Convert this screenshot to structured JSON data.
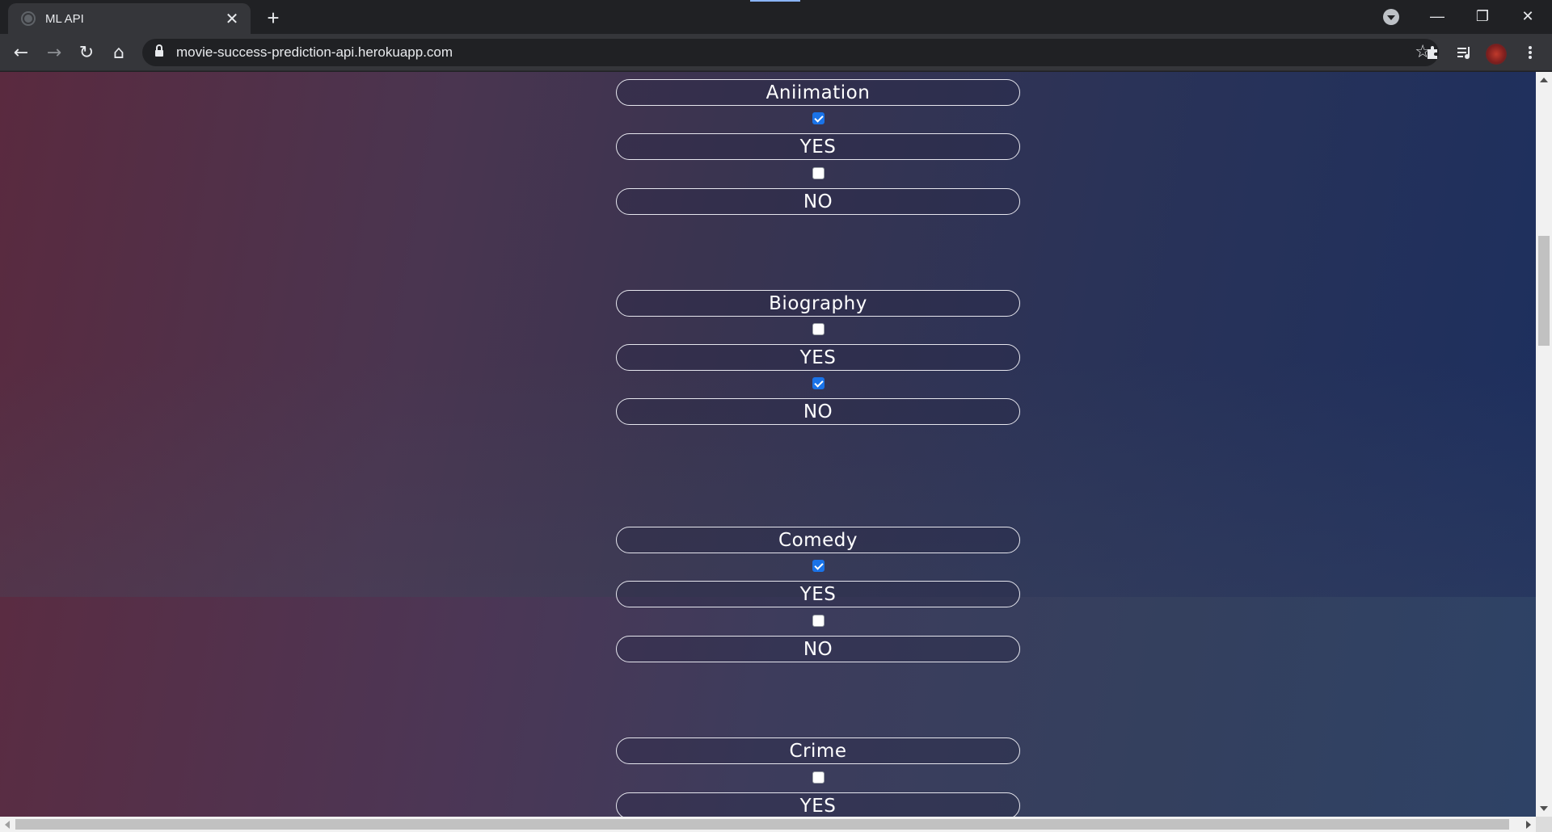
{
  "browser": {
    "tab_title": "ML API",
    "tab_close": "✕",
    "new_tab": "+",
    "url": "movie-success-prediction-api.herokuapp.com",
    "window_controls": {
      "minimize": "—",
      "restore": "❐",
      "close": "✕"
    },
    "nav": {
      "back": "←",
      "forward": "→",
      "reload": "↻",
      "home": "⌂"
    },
    "bookmark_star": "☆"
  },
  "form": {
    "groups": [
      {
        "genre": "Aniimation",
        "yes_label": "YES",
        "no_label": "NO",
        "yes_checked": true,
        "no_checked": false
      },
      {
        "genre": "Biography",
        "yes_label": "YES",
        "no_label": "NO",
        "yes_checked": false,
        "no_checked": true
      },
      {
        "genre": "Comedy",
        "yes_label": "YES",
        "no_label": "NO",
        "yes_checked": true,
        "no_checked": false
      },
      {
        "genre": "Crime",
        "yes_label": "YES",
        "no_checked": false,
        "yes_checked": false
      }
    ]
  },
  "icons": {
    "favicon": "globe-icon",
    "tab_search": "tab-search-icon",
    "extensions": "puzzle-icon",
    "media": "media-queue-icon",
    "menu": "kebab-menu-icon"
  }
}
